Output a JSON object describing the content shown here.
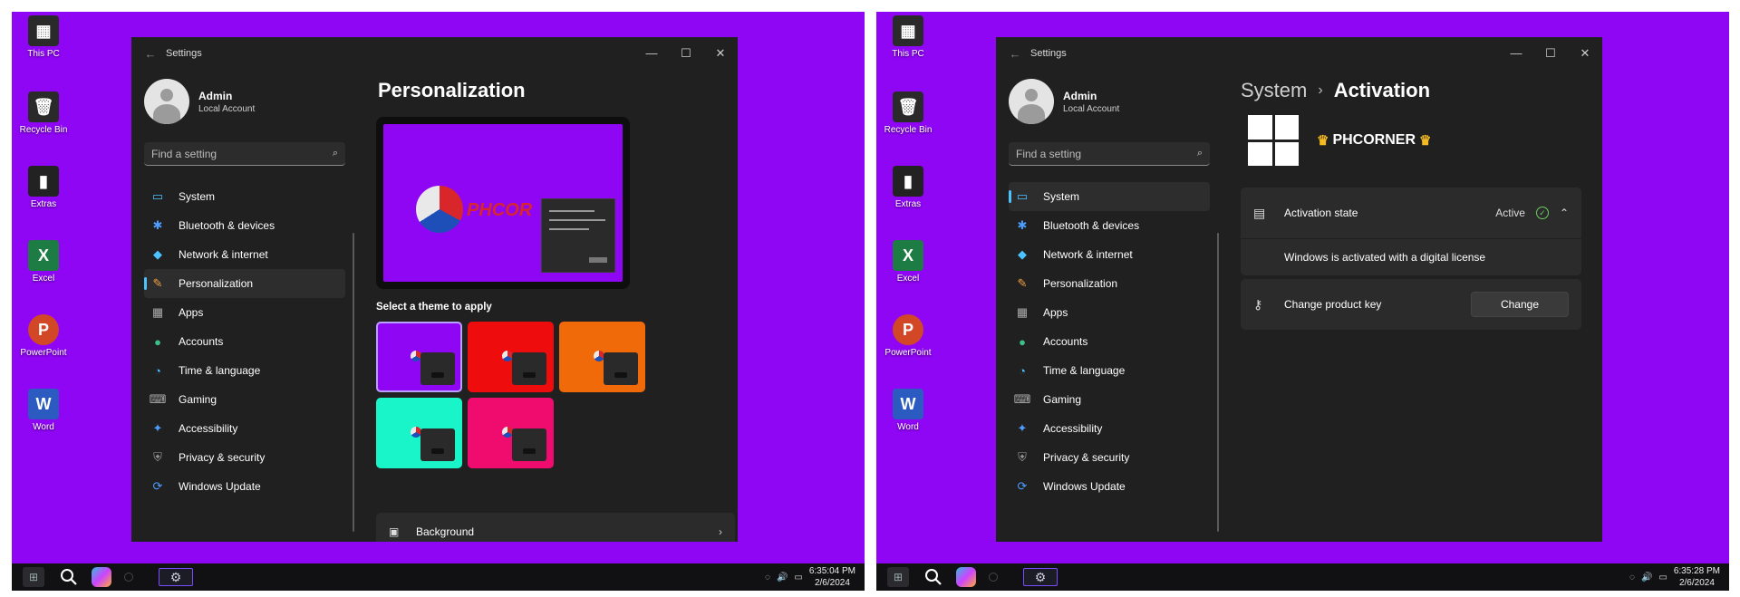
{
  "desktop": {
    "icons": [
      {
        "label": "This PC",
        "icon": "this-pc-icon"
      },
      {
        "label": "Recycle Bin",
        "icon": "recycle-bin-icon"
      },
      {
        "label": "Extras",
        "icon": "extras-icon"
      },
      {
        "label": "Excel",
        "icon": "excel-icon",
        "color": "#1d7c44",
        "glyph": "X"
      },
      {
        "label": "PowerPoint",
        "icon": "powerpoint-icon",
        "color": "#d24726",
        "glyph": "P"
      },
      {
        "label": "Word",
        "icon": "word-icon",
        "color": "#2b5bc1",
        "glyph": "W"
      }
    ]
  },
  "settings": {
    "window_title": "Settings",
    "user_name": "Admin",
    "user_type": "Local Account",
    "search_placeholder": "Find a setting",
    "nav": [
      {
        "label": "System",
        "icon": "system-icon"
      },
      {
        "label": "Bluetooth & devices",
        "icon": "bluetooth-icon"
      },
      {
        "label": "Network & internet",
        "icon": "network-icon"
      },
      {
        "label": "Personalization",
        "icon": "personalization-icon"
      },
      {
        "label": "Apps",
        "icon": "apps-icon"
      },
      {
        "label": "Accounts",
        "icon": "accounts-icon"
      },
      {
        "label": "Time & language",
        "icon": "time-language-icon"
      },
      {
        "label": "Gaming",
        "icon": "gaming-icon"
      },
      {
        "label": "Accessibility",
        "icon": "accessibility-icon"
      },
      {
        "label": "Privacy & security",
        "icon": "privacy-icon"
      },
      {
        "label": "Windows Update",
        "icon": "windows-update-icon"
      }
    ]
  },
  "left": {
    "page_title": "Personalization",
    "preview_brand": "PHCOR",
    "theme_section_label": "Select a theme to apply",
    "themes": [
      {
        "color": "#8f06f5",
        "selected": true
      },
      {
        "color": "#ee0c0c",
        "selected": false
      },
      {
        "color": "#f06a0a",
        "selected": false
      },
      {
        "color": "#19f5c8",
        "selected": false
      },
      {
        "color": "#f00c6e",
        "selected": false
      }
    ],
    "background_label": "Background",
    "clock_time": "6:35:04 PM",
    "clock_date": "2/6/2024"
  },
  "right": {
    "breadcrumb_parent": "System",
    "breadcrumb_sep": "›",
    "page_title": "Activation",
    "edition": "PHCORNER",
    "activation_state_label": "Activation state",
    "activation_state_value": "Active",
    "activation_detail": "Windows is activated with a digital license",
    "product_key_label": "Change product key",
    "change_button": "Change",
    "clock_time": "6:35:28 PM",
    "clock_date": "2/6/2024"
  },
  "colors": {
    "desktop_bg": "#8f06f5",
    "window_bg": "#202020",
    "accent": "#4cc2ff",
    "active_check": "#6ccb5f"
  }
}
